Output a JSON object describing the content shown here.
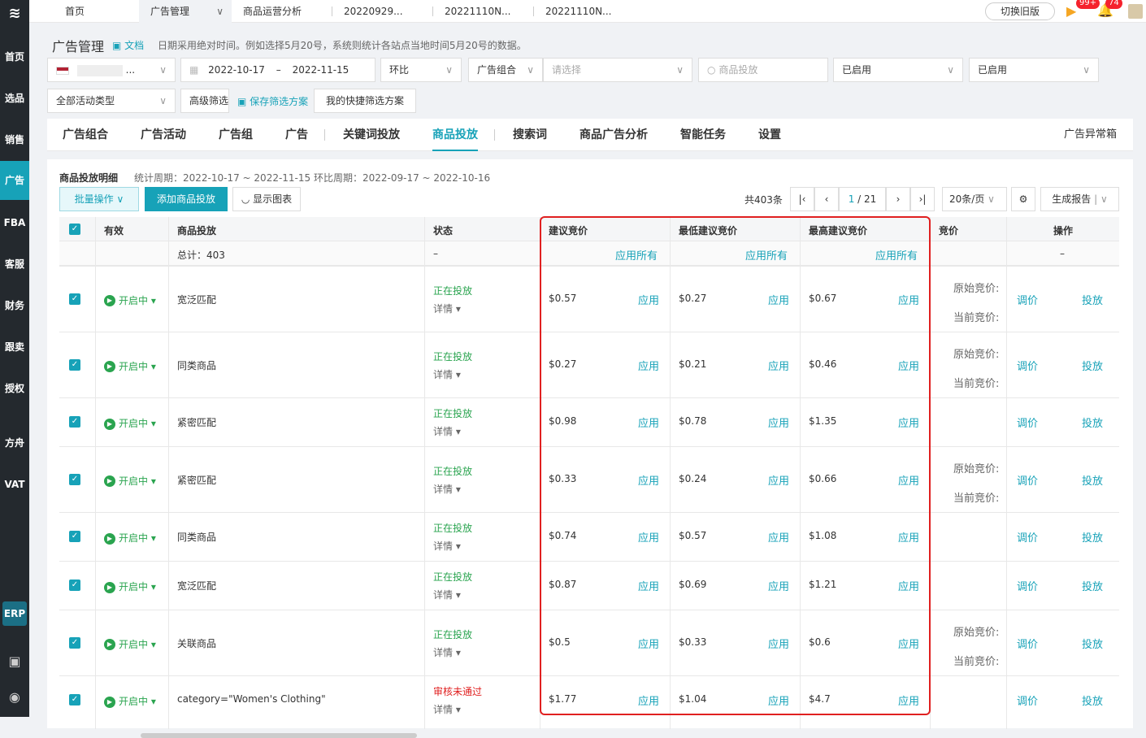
{
  "sidebar": {
    "logo": "≋",
    "items": [
      {
        "label": "首页"
      },
      {
        "label": "选品"
      },
      {
        "label": "销售"
      },
      {
        "label": "广告"
      },
      {
        "label": "FBA"
      },
      {
        "label": "客服"
      },
      {
        "label": "财务"
      },
      {
        "label": "跟卖"
      },
      {
        "label": "授权"
      },
      {
        "label": "方舟"
      },
      {
        "label": "VAT"
      }
    ],
    "erp": "ERP"
  },
  "topbar": {
    "tabs": [
      {
        "label": "首页"
      },
      {
        "label": "广告管理"
      },
      {
        "label": "商品运营分析"
      },
      {
        "label": "20220929..."
      },
      {
        "label": "20221110N..."
      },
      {
        "label": "20221110N..."
      }
    ],
    "close_icon": "∨",
    "switch_label": "切换旧版",
    "badge1": "99+",
    "badge2": "74"
  },
  "header": {
    "title": "广告管理",
    "doc_link": "文档",
    "hint": "日期采用绝对时间。例如选择5月20号，系统则统计各站点当地时间5月20号的数据。"
  },
  "filters": {
    "store": "...",
    "date_start": "2022-10-17",
    "date_sep": "–",
    "date_end": "2022-11-15",
    "compare": "环比",
    "group": "广告组合",
    "group_placeholder": "请选择",
    "search_placeholder": "商品投放",
    "status1": "已启用",
    "status2": "已启用",
    "activity_type": "全部活动类型",
    "advanced": "高级筛选",
    "save_scheme": "保存筛选方案",
    "my_schemes": "我的快捷筛选方案"
  },
  "main_tabs": [
    {
      "label": "广告组合"
    },
    {
      "label": "广告活动"
    },
    {
      "label": "广告组"
    },
    {
      "label": "广告"
    },
    {
      "label": "关键词投放"
    },
    {
      "label": "商品投放"
    },
    {
      "label": "搜索词"
    },
    {
      "label": "商品广告分析"
    },
    {
      "label": "智能任务"
    },
    {
      "label": "设置"
    }
  ],
  "anomaly_box": "广告异常箱",
  "panel": {
    "title": "商品投放明细",
    "period": "统计周期：2022-10-17 ~ 2022-11-15  环比周期：2022-09-17 ~ 2022-10-16",
    "bulk": "批量操作",
    "add": "添加商品投放",
    "chart": "显示图表",
    "total_count": "共403条",
    "page_current": "1",
    "page_total": "/ 21",
    "page_size": "20条/页",
    "report": "生成报告"
  },
  "table": {
    "headers": {
      "valid": "有效",
      "target": "商品投放",
      "status": "状态",
      "suggest": "建议竞价",
      "min": "最低建议竞价",
      "max": "最高建议竞价",
      "bid": "竞价",
      "ops": "操作"
    },
    "summary": {
      "total": "总计：403",
      "dash": "–",
      "apply_all": "应用所有",
      "ops_dash": "–"
    },
    "apply": "应用",
    "on_label": "开启中",
    "detail": "详情",
    "orig_bid": "原始竞价:",
    "cur_bid": "当前竞价:",
    "adjust": "调价",
    "place": "投放",
    "rows": [
      {
        "target": "宽泛匹配",
        "status": "正在投放",
        "suggest": "$0.57",
        "min": "$0.27",
        "max": "$0.67",
        "bids": true
      },
      {
        "target": "同类商品",
        "status": "正在投放",
        "suggest": "$0.27",
        "min": "$0.21",
        "max": "$0.46",
        "bids": true
      },
      {
        "target": "紧密匹配",
        "status": "正在投放",
        "suggest": "$0.98",
        "min": "$0.78",
        "max": "$1.35",
        "bids": false
      },
      {
        "target": "紧密匹配",
        "status": "正在投放",
        "suggest": "$0.33",
        "min": "$0.24",
        "max": "$0.66",
        "bids": true
      },
      {
        "target": "同类商品",
        "status": "正在投放",
        "suggest": "$0.74",
        "min": "$0.57",
        "max": "$1.08",
        "bids": false
      },
      {
        "target": "宽泛匹配",
        "status": "正在投放",
        "suggest": "$0.87",
        "min": "$0.69",
        "max": "$1.21",
        "bids": false
      },
      {
        "target": "关联商品",
        "status": "正在投放",
        "suggest": "$0.5",
        "min": "$0.33",
        "max": "$0.6",
        "bids": true
      },
      {
        "target": "category=\"Women's Clothing\"",
        "status": "审核未通过",
        "suggest": "$1.77",
        "min": "$1.04",
        "max": "$4.7",
        "bids": false
      }
    ]
  },
  "colors": {
    "accent": "#17a2b8",
    "highlight": "#e02020",
    "on": "#2aa44f"
  }
}
